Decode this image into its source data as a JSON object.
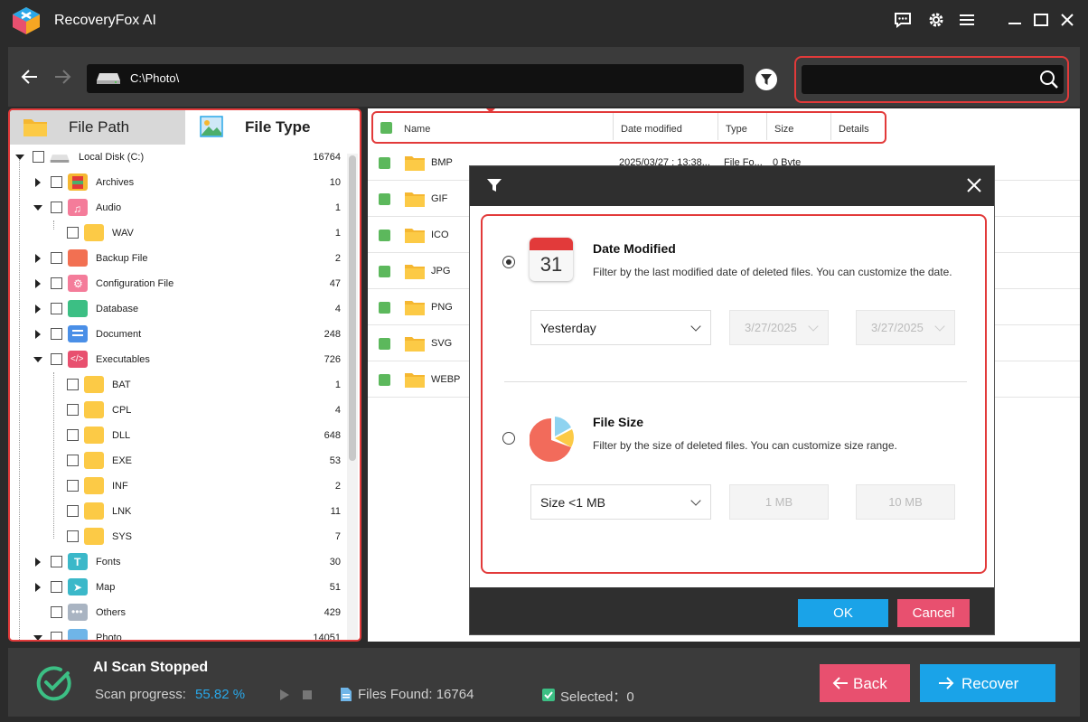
{
  "app": {
    "title": "RecoveryFox AI"
  },
  "nav": {
    "path": "C:\\Photo\\",
    "search_value": ""
  },
  "tabs": {
    "file_path": "File Path",
    "file_type": "File Type"
  },
  "tree": {
    "root": {
      "label": "Local Disk (C:)",
      "count": "16764"
    },
    "items": [
      {
        "label": "Archives",
        "count": "10"
      },
      {
        "label": "Audio",
        "count": "1"
      },
      {
        "label": "WAV",
        "count": "1"
      },
      {
        "label": "Backup File",
        "count": "2"
      },
      {
        "label": "Configuration File",
        "count": "47"
      },
      {
        "label": "Database",
        "count": "4"
      },
      {
        "label": "Document",
        "count": "248"
      },
      {
        "label": "Executables",
        "count": "726"
      },
      {
        "label": "BAT",
        "count": "1"
      },
      {
        "label": "CPL",
        "count": "4"
      },
      {
        "label": "DLL",
        "count": "648"
      },
      {
        "label": "EXE",
        "count": "53"
      },
      {
        "label": "INF",
        "count": "2"
      },
      {
        "label": "LNK",
        "count": "11"
      },
      {
        "label": "SYS",
        "count": "7"
      },
      {
        "label": "Fonts",
        "count": "30"
      },
      {
        "label": "Map",
        "count": "51"
      },
      {
        "label": "Others",
        "count": "429"
      },
      {
        "label": "Photo",
        "count": "14051"
      }
    ]
  },
  "table": {
    "columns": [
      "Name",
      "Date modified",
      "Type",
      "Size",
      "Details"
    ],
    "rows": [
      {
        "name": "BMP",
        "date": "2025/03/27 : 13:38...",
        "type": "File Fo...",
        "size": "0 Byte"
      },
      {
        "name": "GIF"
      },
      {
        "name": "ICO"
      },
      {
        "name": "JPG"
      },
      {
        "name": "PNG"
      },
      {
        "name": "SVG"
      },
      {
        "name": "WEBP"
      }
    ]
  },
  "dialog": {
    "date": {
      "calendar_day": "31",
      "title": "Date Modified",
      "desc": "Filter by the last modified date of deleted files. You can customize the date.",
      "preset": "Yesterday",
      "from": "3/27/2025",
      "to": "3/27/2025",
      "selected": true
    },
    "size": {
      "title": "File Size",
      "desc": "Filter by the size of deleted files. You can customize size range.",
      "preset": "Size <1 MB",
      "min": "1 MB",
      "max": "10 MB",
      "selected": false
    },
    "ok": "OK",
    "cancel": "Cancel"
  },
  "status": {
    "title": "AI Scan Stopped",
    "progress_label": "Scan progress:",
    "progress_value": "55.82 %",
    "files_found": "Files Found: 16764",
    "selected": "Selected：0",
    "back": "Back",
    "recover": "Recover"
  },
  "colors": {
    "accent_blue": "#1aa3e8",
    "accent_pink": "#e8506f",
    "highlight_red": "#e23a3a",
    "check_green": "#5cb85c"
  },
  "icons": [
    "feedback-icon",
    "settings-icon",
    "menu-icon",
    "minimize-icon",
    "maximize-icon",
    "close-icon",
    "back-arrow-icon",
    "forward-arrow-icon",
    "drive-icon",
    "filter-icon",
    "search-icon",
    "calendar-icon",
    "pie-chart-icon",
    "check-circle-icon",
    "play-icon",
    "stop-icon",
    "document-icon"
  ]
}
